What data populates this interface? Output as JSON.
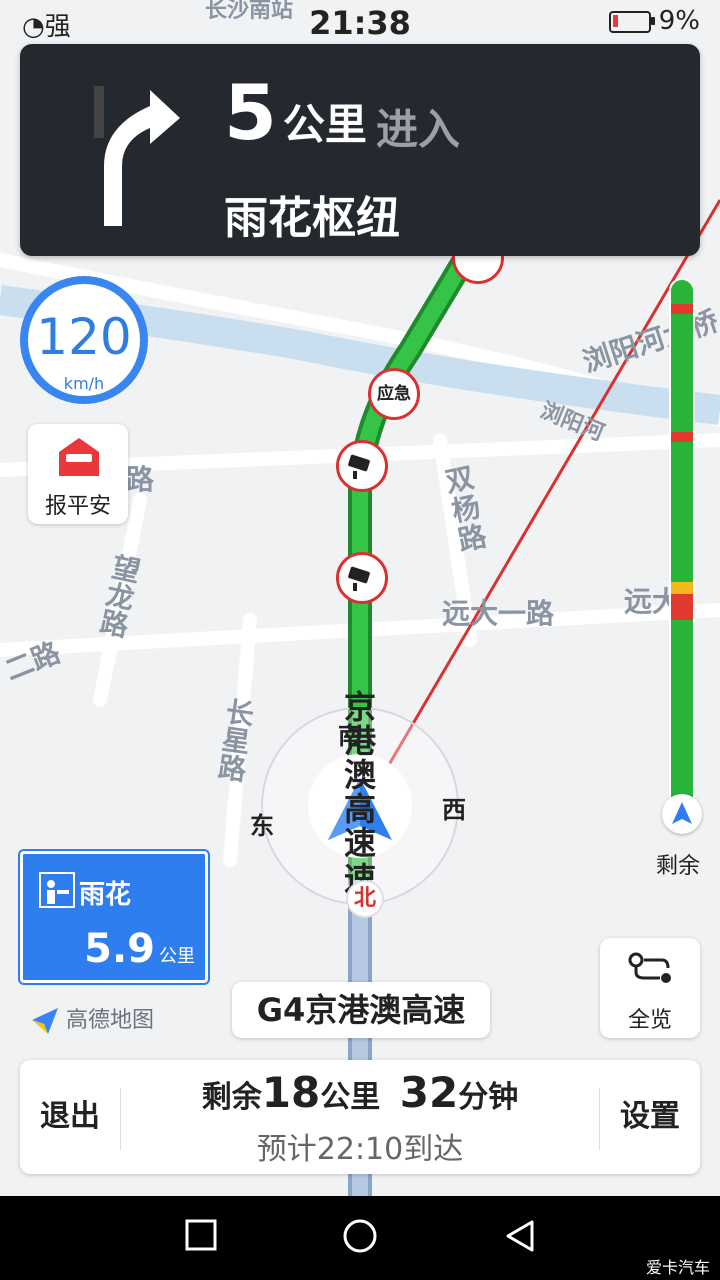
{
  "status_bar": {
    "signal": "强",
    "time": "21:38",
    "battery": "9%"
  },
  "map": {
    "road_labels": {
      "changsha_south": "长沙南站",
      "liuyang_bridge": "浏阳河大桥",
      "liuyang_river": "浏阳河",
      "shuangyang": "双杨路",
      "yuanda": "远大一路",
      "yuanda_right": "远大",
      "wanglong": "望龙路",
      "changxing": "长星路",
      "er_road": "二路",
      "road_fragment": "路",
      "jinggang": "京港澳高速",
      "jinggang_bottom": "速"
    },
    "compass": {
      "north": "北",
      "south": "南",
      "east": "东",
      "west": "西"
    },
    "markers": {
      "emergency": "应急"
    }
  },
  "guidance": {
    "distance_value": "5",
    "distance_unit": "公里",
    "action": "进入",
    "road": "雨花枢纽"
  },
  "speed_limit": {
    "value": "120",
    "unit": "km/h"
  },
  "report_button": {
    "label": "报平安"
  },
  "traffic_bar": {
    "label": "剩余"
  },
  "exit_sign": {
    "name": "雨花",
    "distance": "5.9",
    "unit": "公里"
  },
  "overview_button": {
    "label": "全览"
  },
  "logo": {
    "text": "高德地图"
  },
  "current_road": "G4京港澳高速",
  "bottom_panel": {
    "exit_label": "退出",
    "settings_label": "设置",
    "remain_prefix": "剩余",
    "remain_distance": "18",
    "remain_distance_unit": "公里",
    "remain_time": "32",
    "remain_time_unit": "分钟",
    "eta_text": "预计22:10到达"
  },
  "watermark": "爱卡汽车",
  "colors": {
    "route_green": "#28b53a",
    "jam_red": "#e23a2f",
    "slow_yellow": "#f2b91c",
    "accent_blue": "#2f7ef0",
    "guide_dark": "#24292f"
  }
}
